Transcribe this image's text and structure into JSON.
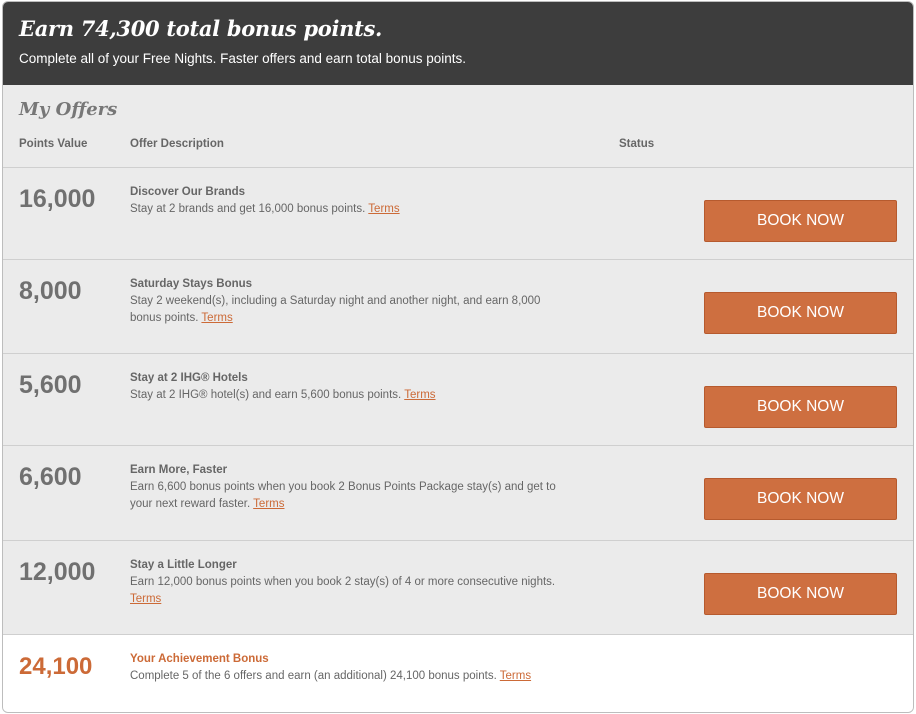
{
  "banner": {
    "title": "Earn 74,300 total bonus points.",
    "subtitle": "Complete all of your Free Nights. Faster offers and earn total bonus points."
  },
  "offers": {
    "title": "My Offers",
    "columns": {
      "points": "Points Value",
      "description": "Offer Description",
      "status": "Status"
    },
    "rows": [
      {
        "points": "16,000",
        "title": "Discover Our Brands",
        "text": "Stay at 2 brands and get 16,000 bonus points.",
        "terms": "Terms",
        "button": "BOOK NOW"
      },
      {
        "points": "8,000",
        "title": "Saturday Stays Bonus",
        "text": "Stay 2 weekend(s), including a Saturday night and another night, and earn 8,000 bonus points.",
        "terms": "Terms",
        "button": "BOOK NOW"
      },
      {
        "points": "5,600",
        "title": "Stay at 2 IHG® Hotels",
        "text": "Stay at 2 IHG® hotel(s) and earn 5,600 bonus points.",
        "terms": "Terms",
        "button": "BOOK NOW"
      },
      {
        "points": "6,600",
        "title": "Earn More, Faster",
        "text": "Earn 6,600 bonus points when you book 2 Bonus Points Package stay(s) and get to your next reward faster.",
        "terms": "Terms",
        "button": "BOOK NOW"
      },
      {
        "points": "12,000",
        "title": "Stay a Little Longer",
        "text": "Earn 12,000 bonus points when you book 2 stay(s) of 4 or more consecutive nights.",
        "terms": "Terms",
        "button": "BOOK NOW"
      }
    ],
    "bonus": {
      "points": "24,100",
      "title": "Your Achievement Bonus",
      "text": "Complete 5 of the 6 offers and earn (an additional) 24,100 bonus points.",
      "terms": "Terms"
    }
  },
  "colors": {
    "accent": "#cc6a37",
    "button": "#ce6f40",
    "banner": "#3d3d3d",
    "panel": "#ebebeb"
  }
}
